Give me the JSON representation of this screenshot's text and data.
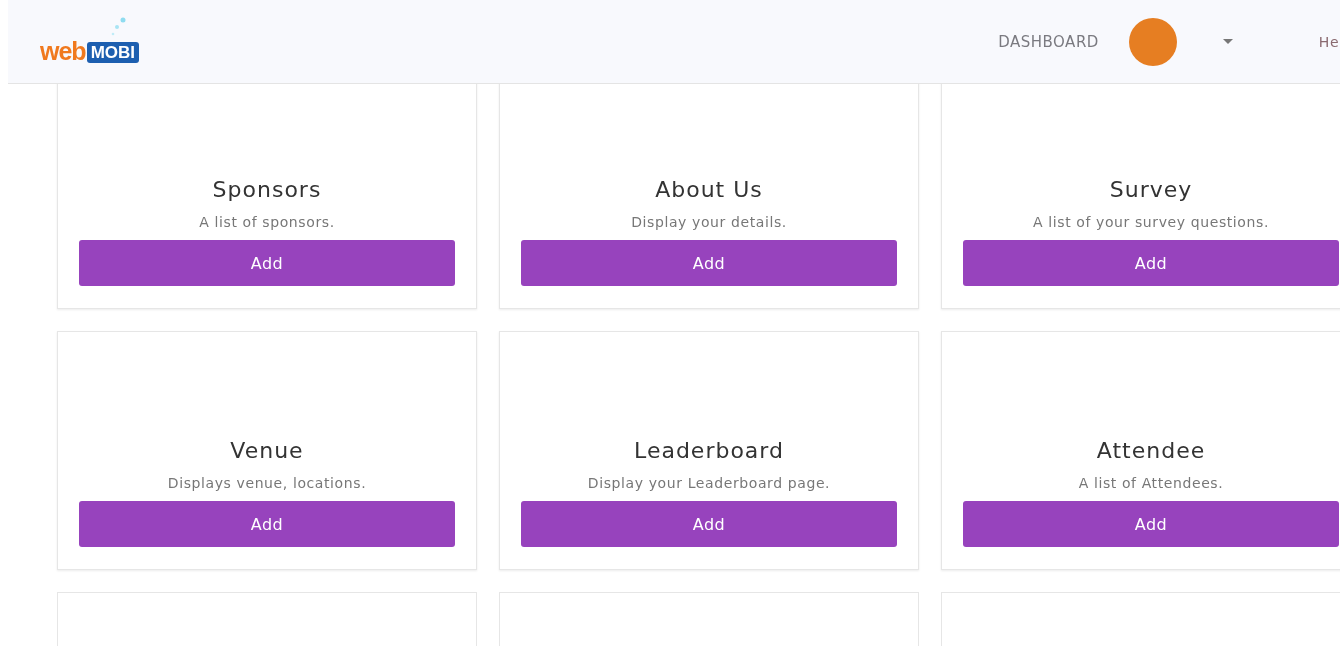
{
  "header": {
    "logo": {
      "part_1": "web",
      "part_2": "MOBI"
    },
    "nav_link": "DASHBOARD",
    "help_link": "He"
  },
  "cards": [
    {
      "kind": "feature",
      "title": "Sponsors",
      "description": "A list of sponsors.",
      "button": "Add"
    },
    {
      "kind": "feature",
      "title": "About Us",
      "description": "Display your details.",
      "button": "Add"
    },
    {
      "kind": "feature",
      "title": "Survey",
      "description": "A list of your survey questions.",
      "button": "Add"
    },
    {
      "kind": "feature",
      "title": "Venue",
      "description": "Displays venue, locations.",
      "button": "Add"
    },
    {
      "kind": "feature",
      "title": "Leaderboard",
      "description": "Display your Leaderboard page.",
      "button": "Add"
    },
    {
      "kind": "feature",
      "title": "Attendee",
      "description": "A list of Attendees.",
      "button": "Add"
    },
    {
      "kind": "blank"
    },
    {
      "kind": "blank"
    },
    {
      "kind": "blank"
    }
  ]
}
